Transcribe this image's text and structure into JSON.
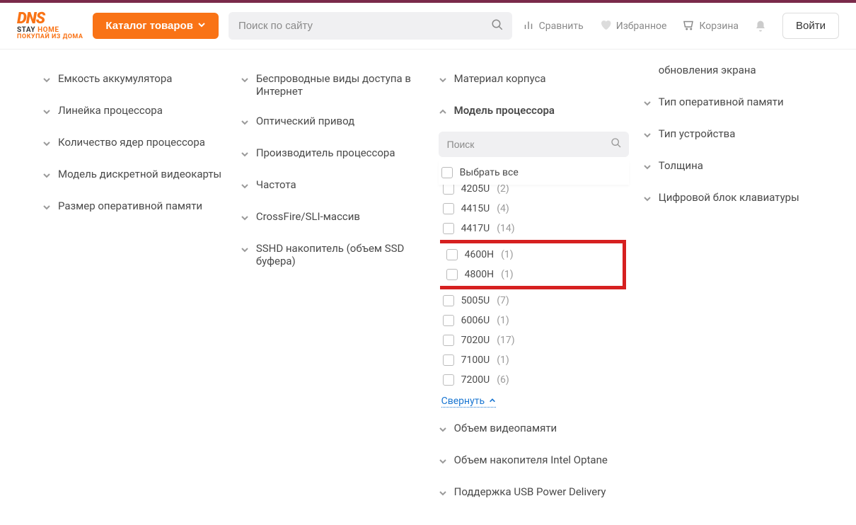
{
  "header": {
    "logo": {
      "main": "DNS",
      "line1_a": "STAY",
      "line1_b": "HOME",
      "line2": "ПОКУПАЙ ИЗ ДОМА"
    },
    "catalog_button": "Каталог товаров",
    "search_placeholder": "Поиск по сайту",
    "compare": "Сравнить",
    "favorites": "Избранное",
    "cart": "Корзина",
    "login": "Войти"
  },
  "filters": {
    "col1": [
      "Емкость аккумулятора",
      "Линейка процессора",
      "Количество ядер процессора",
      "Модель дискретной видеокарты",
      "Размер оперативной памяти"
    ],
    "col2": [
      "Беспроводные виды доступа в Интернет",
      "Оптический привод",
      "Производитель процессора",
      "Частота",
      "CrossFire/SLI-массив",
      "SSHD накопитель (объем SSD буфера)"
    ],
    "col3_top": [
      "Материал корпуса"
    ],
    "cpu_model": {
      "title": "Модель процессора",
      "search_placeholder": "Поиск",
      "select_all": "Выбрать все",
      "options": [
        {
          "label": "4205U",
          "count": 2,
          "highlight": false
        },
        {
          "label": "4415U",
          "count": 4,
          "highlight": false
        },
        {
          "label": "4417U",
          "count": 14,
          "highlight": false
        },
        {
          "label": "4600H",
          "count": 1,
          "highlight": true
        },
        {
          "label": "4800H",
          "count": 1,
          "highlight": true
        },
        {
          "label": "5005U",
          "count": 7,
          "highlight": false
        },
        {
          "label": "6006U",
          "count": 1,
          "highlight": false
        },
        {
          "label": "7020U",
          "count": 17,
          "highlight": false
        },
        {
          "label": "7100U",
          "count": 1,
          "highlight": false
        },
        {
          "label": "7200U",
          "count": 6,
          "highlight": false
        }
      ],
      "collapse": "Свернуть"
    },
    "col3_bottom": [
      "Объем видеопамяти",
      "Объем накопителя Intel Optane",
      "Поддержка USB Power Delivery"
    ],
    "col4_top_partial": "обновления экрана",
    "col4": [
      "Тип оперативной памяти",
      "Тип устройства",
      "Толщина",
      "Цифровой блок клавиатуры"
    ]
  }
}
